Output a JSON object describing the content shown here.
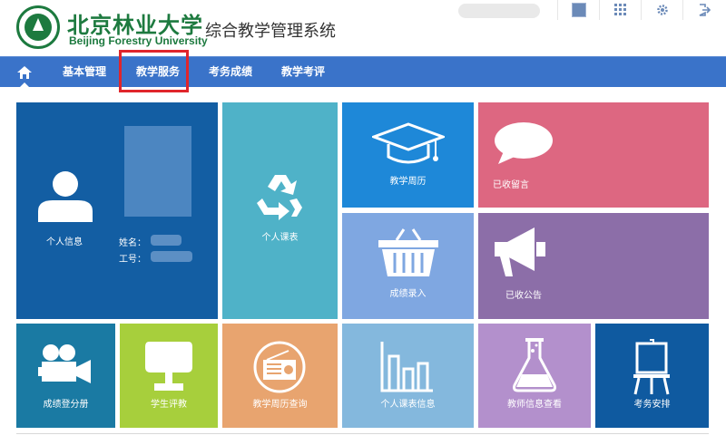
{
  "header": {
    "university_cn": "北京林业大学",
    "university_en": "Beijing Forestry University",
    "system_title": "综合教学管理系统",
    "icons": [
      "user-avatar-icon",
      "grid-icon",
      "gear-icon",
      "logout-icon"
    ]
  },
  "nav": {
    "home_icon": "home-icon",
    "items": [
      "基本管理",
      "教学服务",
      "考务成绩",
      "教学考评"
    ],
    "highlight_color": "#e0252b"
  },
  "profile": {
    "label": "个人信息",
    "name_label": "姓名：",
    "id_label": "工号："
  },
  "tiles": {
    "personal_schedule": "个人课表",
    "teaching_calendar": "教学周历",
    "received_messages": "已收留言",
    "grade_entry": "成绩录入",
    "received_notices": "已收公告",
    "grade_register": "成绩登分册",
    "student_evaluation": "学生评教",
    "calendar_query": "教学周历查询",
    "schedule_info": "个人课表信息",
    "teacher_info": "教师信息查看",
    "exam_arrangement": "考务安排"
  },
  "colors": {
    "nav_bar": "#3a73c9",
    "profile_tile": "#135ea3",
    "teal_tile": "#4fb2c8",
    "blue_tile": "#1e88d8",
    "pink_tile": "#dd6781",
    "lavender_tile": "#7fa7e1",
    "purple_tile": "#8c6ea8",
    "green_tile": "#a7cf3c",
    "orange_tile": "#e8a46f",
    "lightblue_tile": "#84b8dd",
    "lilac_tile": "#b390cc",
    "dark_teal_tile": "#1a7aa3",
    "navy_tile": "#0f5aa0"
  }
}
